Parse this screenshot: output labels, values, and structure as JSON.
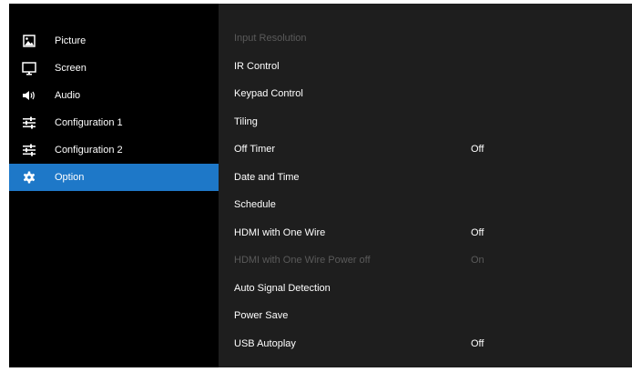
{
  "sidebar": {
    "items": [
      {
        "label": "Picture",
        "icon": "picture-icon",
        "active": false
      },
      {
        "label": "Screen",
        "icon": "screen-icon",
        "active": false
      },
      {
        "label": "Audio",
        "icon": "audio-icon",
        "active": false
      },
      {
        "label": "Configuration 1",
        "icon": "sliders-icon",
        "active": false
      },
      {
        "label": "Configuration 2",
        "icon": "sliders-icon",
        "active": false
      },
      {
        "label": "Option",
        "icon": "gear-icon",
        "active": true
      }
    ]
  },
  "options": {
    "items": [
      {
        "label": "Input Resolution",
        "value": "",
        "enabled": false
      },
      {
        "label": "IR Control",
        "value": "",
        "enabled": true
      },
      {
        "label": "Keypad Control",
        "value": "",
        "enabled": true
      },
      {
        "label": "Tiling",
        "value": "",
        "enabled": true
      },
      {
        "label": "Off Timer",
        "value": "Off",
        "enabled": true
      },
      {
        "label": "Date and Time",
        "value": "",
        "enabled": true
      },
      {
        "label": "Schedule",
        "value": "",
        "enabled": true
      },
      {
        "label": "HDMI with One Wire",
        "value": "Off",
        "enabled": true
      },
      {
        "label": "HDMI with One Wire Power off",
        "value": "On",
        "enabled": false
      },
      {
        "label": "Auto Signal Detection",
        "value": "",
        "enabled": true
      },
      {
        "label": "Power Save",
        "value": "",
        "enabled": true
      },
      {
        "label": "USB Autoplay",
        "value": "Off",
        "enabled": true
      }
    ]
  },
  "colors": {
    "active_highlight": "#1e78c8",
    "panel_left": "#000000",
    "panel_right": "#1e1e1e",
    "text": "#ffffff",
    "text_disabled": "#5a5a5a"
  }
}
